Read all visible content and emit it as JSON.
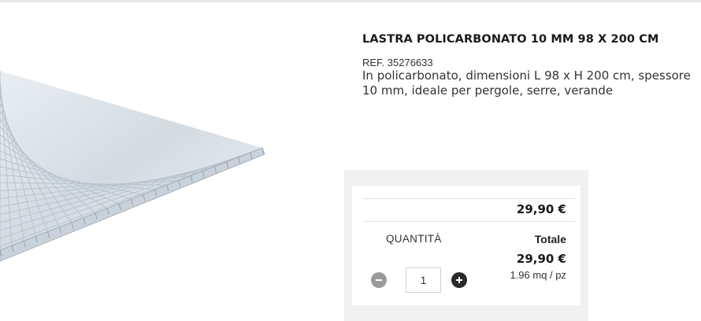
{
  "product": {
    "title": "LASTRA POLICARBONATO 10 MM 98 X 200 CM",
    "ref": "REF. 35276633",
    "description": "In policarbonato, dimensioni L 98 x H 200 cm, spessore 10 mm, ideale per pergole, serre, verande",
    "image_icon": "polycarbonate-sheet-image"
  },
  "purchase": {
    "unit_price": "29,90 €",
    "quantity_label": "QUANTITÀ",
    "total_label": "Totale",
    "total_price": "29,90 €",
    "unit_measure": "1.96 mq / pz",
    "quantity_value": "1",
    "minus_icon": "minus-icon",
    "plus_icon": "plus-icon"
  },
  "colors": {
    "minus_button": "#9a9a9a",
    "plus_button": "#2a2a2a",
    "box_background": "#f1f1f1"
  }
}
